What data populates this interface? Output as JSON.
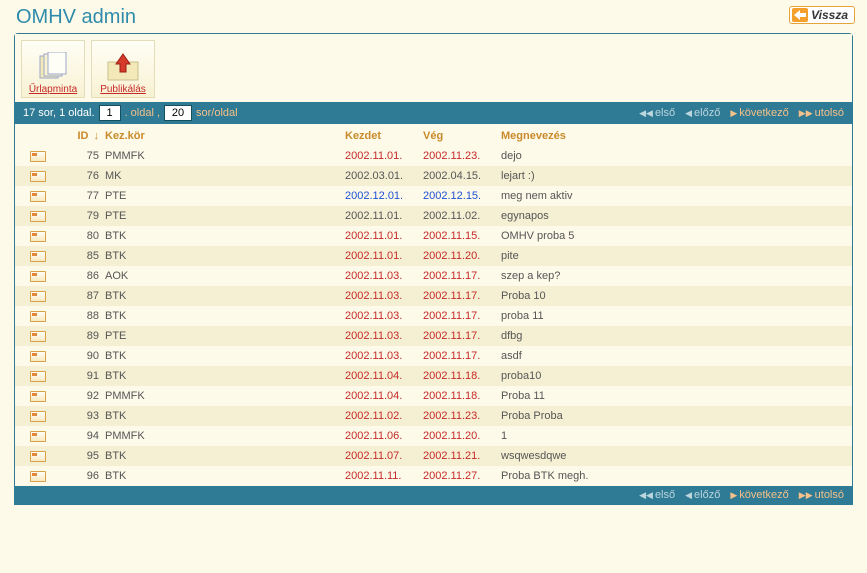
{
  "header": {
    "title": "OMHV admin",
    "back_label": "Vissza"
  },
  "toolbar": {
    "btn1": "Űrlapminta",
    "btn2": "Publikálás"
  },
  "pager": {
    "summary": "17 sor, 1 oldal.",
    "page_value": "1",
    "page_label": ". oldal ,",
    "size_value": "20",
    "size_label": "sor/oldal",
    "nav_first": "első",
    "nav_prev": "előző",
    "nav_next": "következő",
    "nav_last": "utolsó"
  },
  "columns": {
    "id": "ID",
    "kor": "Kez.kör",
    "kezdet": "Kezdet",
    "veg": "Vég",
    "megn": "Megnevezés"
  },
  "rows": [
    {
      "id": "75",
      "kor": "PMMFK",
      "kezdet": "2002.11.01.",
      "kcolor": "red",
      "veg": "2002.11.23.",
      "vcolor": "red",
      "name": "dejo"
    },
    {
      "id": "76",
      "kor": "MK",
      "kezdet": "2002.03.01.",
      "kcolor": "gray",
      "veg": "2002.04.15.",
      "vcolor": "gray",
      "name": "lejart :)"
    },
    {
      "id": "77",
      "kor": "PTE",
      "kezdet": "2002.12.01.",
      "kcolor": "blue",
      "veg": "2002.12.15.",
      "vcolor": "blue",
      "name": "meg nem aktiv"
    },
    {
      "id": "79",
      "kor": "PTE",
      "kezdet": "2002.11.01.",
      "kcolor": "gray",
      "veg": "2002.11.02.",
      "vcolor": "gray",
      "name": "egynapos"
    },
    {
      "id": "80",
      "kor": "BTK",
      "kezdet": "2002.11.01.",
      "kcolor": "red",
      "veg": "2002.11.15.",
      "vcolor": "red",
      "name": "OMHV proba 5"
    },
    {
      "id": "85",
      "kor": "BTK",
      "kezdet": "2002.11.01.",
      "kcolor": "red",
      "veg": "2002.11.20.",
      "vcolor": "red",
      "name": "pite"
    },
    {
      "id": "86",
      "kor": "AOK",
      "kezdet": "2002.11.03.",
      "kcolor": "red",
      "veg": "2002.11.17.",
      "vcolor": "red",
      "name": "szep a kep?"
    },
    {
      "id": "87",
      "kor": "BTK",
      "kezdet": "2002.11.03.",
      "kcolor": "red",
      "veg": "2002.11.17.",
      "vcolor": "red",
      "name": "Proba 10"
    },
    {
      "id": "88",
      "kor": "BTK",
      "kezdet": "2002.11.03.",
      "kcolor": "red",
      "veg": "2002.11.17.",
      "vcolor": "red",
      "name": "proba 11"
    },
    {
      "id": "89",
      "kor": "PTE",
      "kezdet": "2002.11.03.",
      "kcolor": "red",
      "veg": "2002.11.17.",
      "vcolor": "red",
      "name": "dfbg"
    },
    {
      "id": "90",
      "kor": "BTK",
      "kezdet": "2002.11.03.",
      "kcolor": "red",
      "veg": "2002.11.17.",
      "vcolor": "red",
      "name": "asdf"
    },
    {
      "id": "91",
      "kor": "BTK",
      "kezdet": "2002.11.04.",
      "kcolor": "red",
      "veg": "2002.11.18.",
      "vcolor": "red",
      "name": "proba10"
    },
    {
      "id": "92",
      "kor": "PMMFK",
      "kezdet": "2002.11.04.",
      "kcolor": "red",
      "veg": "2002.11.18.",
      "vcolor": "red",
      "name": "Proba 11"
    },
    {
      "id": "93",
      "kor": "BTK",
      "kezdet": "2002.11.02.",
      "kcolor": "red",
      "veg": "2002.11.23.",
      "vcolor": "red",
      "name": "Proba Proba"
    },
    {
      "id": "94",
      "kor": "PMMFK",
      "kezdet": "2002.11.06.",
      "kcolor": "red",
      "veg": "2002.11.20.",
      "vcolor": "red",
      "name": "1"
    },
    {
      "id": "95",
      "kor": "BTK",
      "kezdet": "2002.11.07.",
      "kcolor": "red",
      "veg": "2002.11.21.",
      "vcolor": "red",
      "name": "wsqwesdqwe"
    },
    {
      "id": "96",
      "kor": "BTK",
      "kezdet": "2002.11.11.",
      "kcolor": "red",
      "veg": "2002.11.27.",
      "vcolor": "red",
      "name": "Proba BTK megh."
    }
  ]
}
